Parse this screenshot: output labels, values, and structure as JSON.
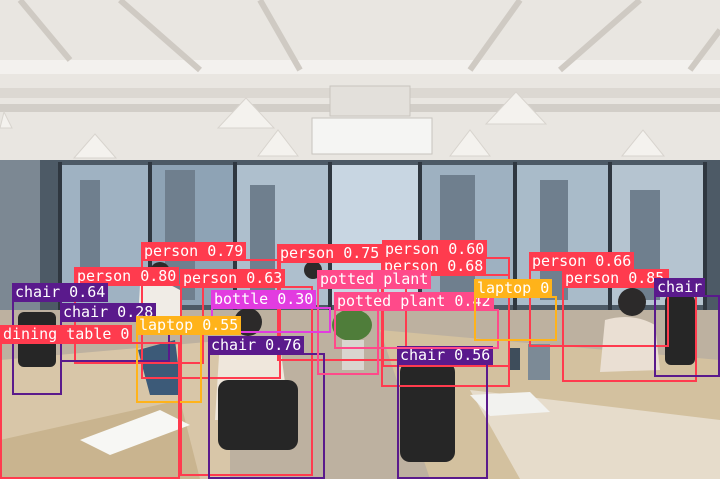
{
  "colors": {
    "person": "#ff3b4e",
    "chair": "#5a1a8c",
    "potted plant": "#ff4a8a",
    "bottle": "#e23ce0",
    "laptop": "#ffb31a",
    "dining table": "#ff3b4e"
  },
  "detections": [
    {
      "label": "person 0.79",
      "cls": "person"
    },
    {
      "label": "person 0.75",
      "cls": "person"
    },
    {
      "label": "person 0.60",
      "cls": "person"
    },
    {
      "label": "person 0.80",
      "cls": "person"
    },
    {
      "label": "person 0.63",
      "cls": "person"
    },
    {
      "label": "person 0.68",
      "cls": "person"
    },
    {
      "label": "person 0.66",
      "cls": "person"
    },
    {
      "label": "person 0.85",
      "cls": "person"
    },
    {
      "label": "chair 0.64",
      "cls": "chair"
    },
    {
      "label": "chair 0.28",
      "cls": "chair"
    },
    {
      "label": "chair 0.76",
      "cls": "chair"
    },
    {
      "label": "chair 0.56",
      "cls": "chair"
    },
    {
      "label": "chair",
      "cls": "chair"
    },
    {
      "label": "potted plant",
      "cls": "potted plant"
    },
    {
      "label": "potted plant 0.42",
      "cls": "potted plant"
    },
    {
      "label": "bottle 0.30",
      "cls": "bottle"
    },
    {
      "label": "laptop 0.55",
      "cls": "laptop"
    },
    {
      "label": "laptop 0",
      "cls": "laptop"
    },
    {
      "label": "dining table 0",
      "cls": "dining table"
    }
  ]
}
